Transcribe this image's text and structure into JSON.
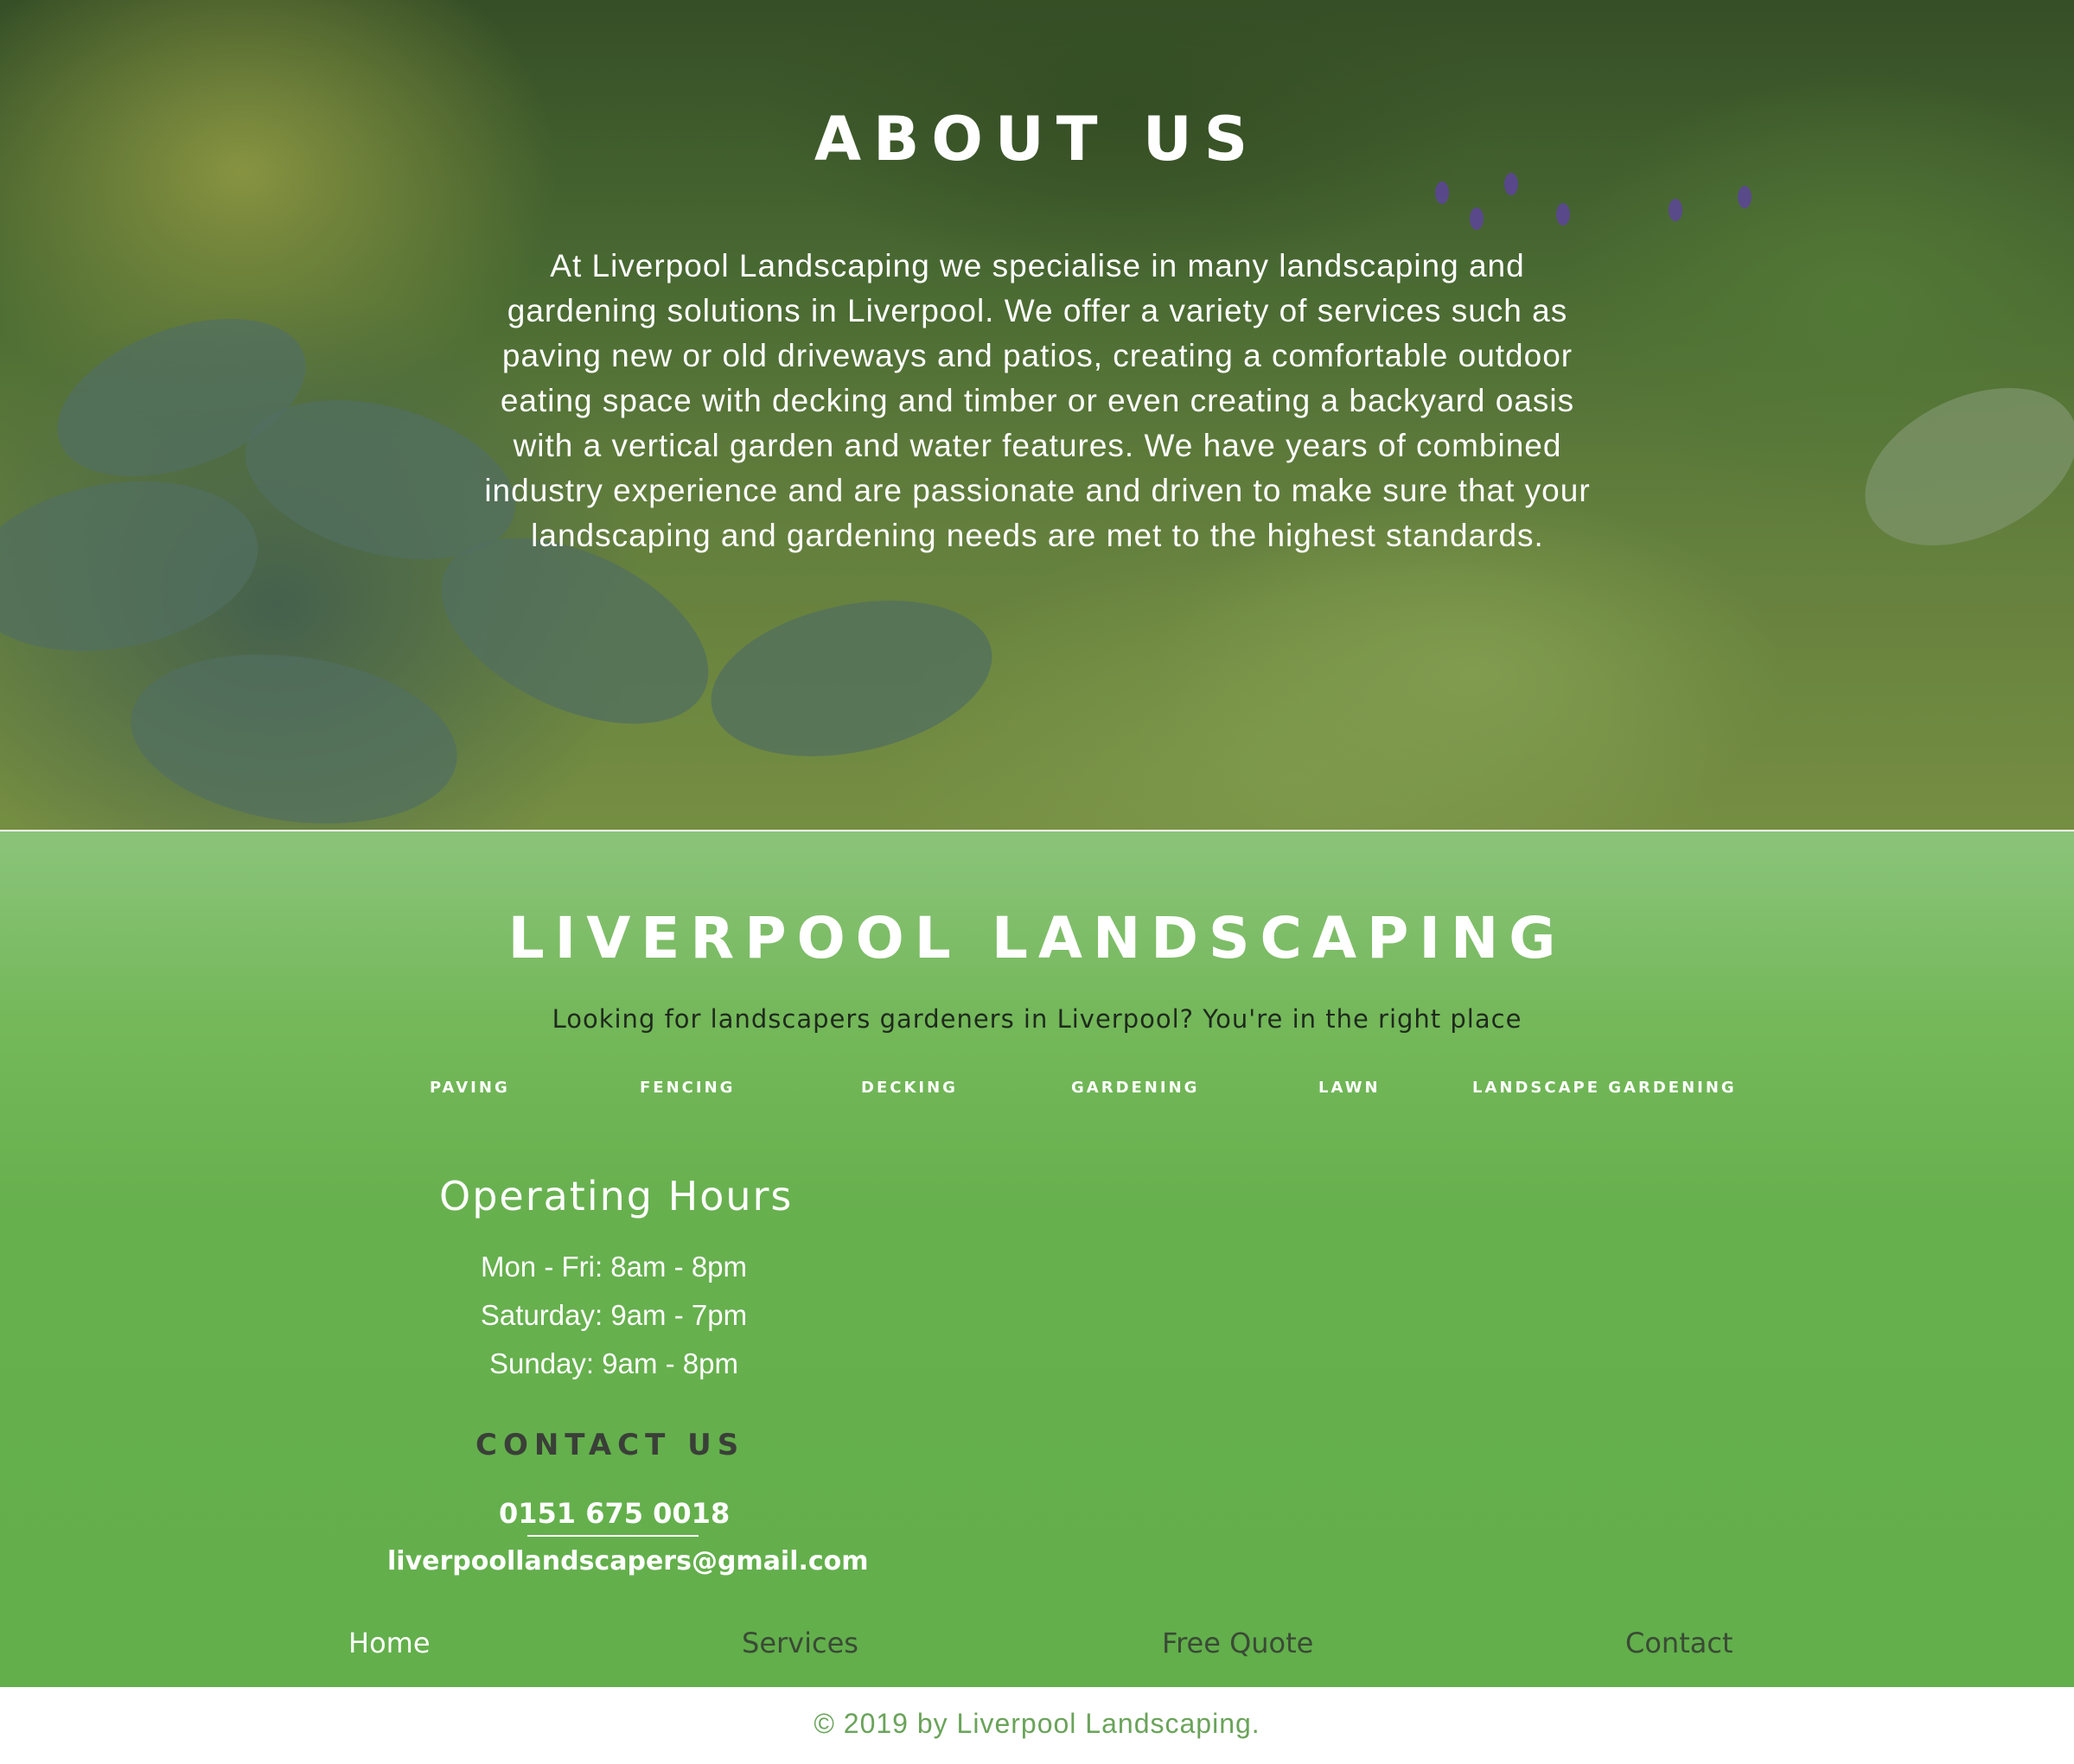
{
  "about": {
    "title": "ABOUT US",
    "text": "At Liverpool Landscaping we specialise in many landscaping and gardening solutions in Liverpool. We offer a variety of services such as paving new or old driveways and patios, creating a comfortable outdoor eating space with decking and timber or even creating a backyard oasis with a vertical garden and water features. We have years of combined industry experience and are passionate and driven to make sure that your landscaping and gardening needs are met to the highest standards."
  },
  "footer": {
    "brand": "LIVERPOOL LANDSCAPING",
    "tagline": "Looking for landscapers gardeners in Liverpool? You're in the right place",
    "services": [
      "PAVING",
      "FENCING",
      "DECKING",
      "GARDENING",
      "LAWN",
      "LANDSCAPE GARDENING"
    ],
    "hours_title": "Operating Hours",
    "hours": [
      "Mon - Fri: 8am - 8pm",
      "Saturday: 9am - 7pm",
      "Sunday: 9am - 8pm"
    ],
    "contact_title": "CONTACT US",
    "phone": "0151 675 0018",
    "email": "liverpoollandscapers@gmail.com",
    "nav": [
      "Home",
      "Services",
      "Free Quote",
      "Contact"
    ]
  },
  "copyright": "© 2019 by Liverpool Landscaping.",
  "colors": {
    "green_top": "#8bc47a",
    "green_main": "#62af4b",
    "copyright_text": "#6aa35a"
  }
}
